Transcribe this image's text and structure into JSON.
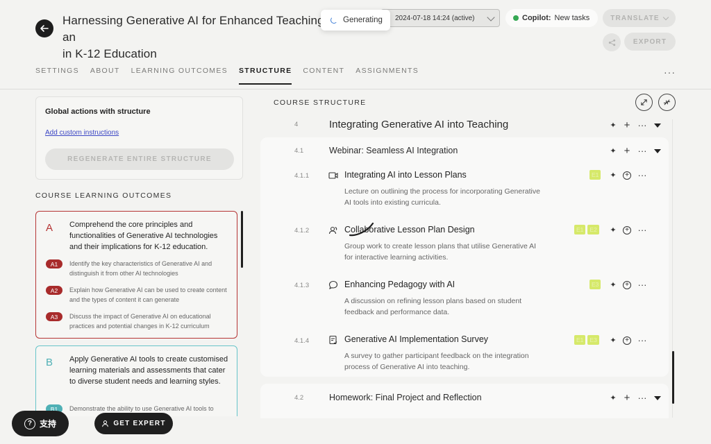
{
  "header": {
    "title": "Harnessing Generative AI for Enhanced Teaching and Learning in K-12 Education",
    "title_line1": "Harnessing Generative AI for Enhanced Teaching an",
    "title_line2": "in K-12 Education",
    "generating_label": "Generating",
    "version_value": "2024-07-18 14:24 (active)",
    "copilot_label": "Copilot:",
    "copilot_status": "New tasks",
    "translate_label": "TRANSLATE",
    "export_label": "EXPORT",
    "colors": {
      "copilot_dot": "#35a853",
      "accent": "#1f1f1f"
    }
  },
  "tabs": [
    {
      "label": "SETTINGS"
    },
    {
      "label": "ABOUT"
    },
    {
      "label": "LEARNING OUTCOMES"
    },
    {
      "label": "STRUCTURE",
      "active": true
    },
    {
      "label": "CONTENT"
    },
    {
      "label": "ASSIGNMENTS"
    }
  ],
  "tabs_more": "···",
  "global_actions": {
    "title": "Global actions with structure",
    "link": "Add custom instructions",
    "regenerate_label": "REGENERATE ENTIRE STRUCTURE"
  },
  "learning_outcomes": {
    "title": "COURSE LEARNING OUTCOMES",
    "items": [
      {
        "letter": "A",
        "text": "Comprehend the core principles and functionalities of Generative AI technologies and their implications for K-12 education.",
        "color": "#b53434",
        "subs": [
          {
            "code": "A1",
            "text": "Identify the key characteristics of Generative AI and distinguish it from other AI technologies"
          },
          {
            "code": "A2",
            "text": "Explain how Generative AI can be used to create content and the types of content it can generate"
          },
          {
            "code": "A3",
            "text": "Discuss the impact of Generative AI on educational practices and potential changes in K-12 curriculum"
          }
        ]
      },
      {
        "letter": "B",
        "text": "Apply Generative AI tools to create customised learning materials and assessments that cater to diverse student needs and learning styles.",
        "color": "#4fb0b5",
        "subs": [
          {
            "code": "B1",
            "text": "Demonstrate the ability to use Generative AI tools to"
          }
        ]
      }
    ]
  },
  "course_structure": {
    "title": "COURSE STRUCTURE",
    "module": {
      "num": "4",
      "title": "Integrating Generative AI into Teaching"
    },
    "sections": [
      {
        "num": "4.1",
        "title": "Webinar: Seamless AI Integration",
        "activities": [
          {
            "num": "4.1.1",
            "icon": "video-icon",
            "title": "Integrating AI into Lesson Plans",
            "desc": "Lecture on outlining the process for incorporating Generative AI tools into existing curricula.",
            "badges": [
              "E1"
            ]
          },
          {
            "num": "4.1.2",
            "icon": "group-icon",
            "title": "Collaborative Lesson Plan Design",
            "desc": "Group work to create lesson plans that utilise Generative AI for interactive learning activities.",
            "badges": [
              "E1",
              "E2"
            ]
          },
          {
            "num": "4.1.3",
            "icon": "chat-icon",
            "title": "Enhancing Pedagogy with AI",
            "desc": "A discussion on refining lesson plans based on student feedback and performance data.",
            "badges": [
              "E3"
            ]
          },
          {
            "num": "4.1.4",
            "icon": "survey-icon",
            "title": "Generative AI Implementation Survey",
            "desc": "A survey to gather participant feedback on the integration process of Generative AI into teaching.",
            "badges": [
              "E1",
              "E3"
            ]
          }
        ]
      },
      {
        "num": "4.2",
        "title": "Homework: Final Project and Reflection"
      }
    ],
    "badge_color": "#d6e96a"
  },
  "footer": {
    "support_label": "支持",
    "expert_label": "GET EXPERT"
  }
}
